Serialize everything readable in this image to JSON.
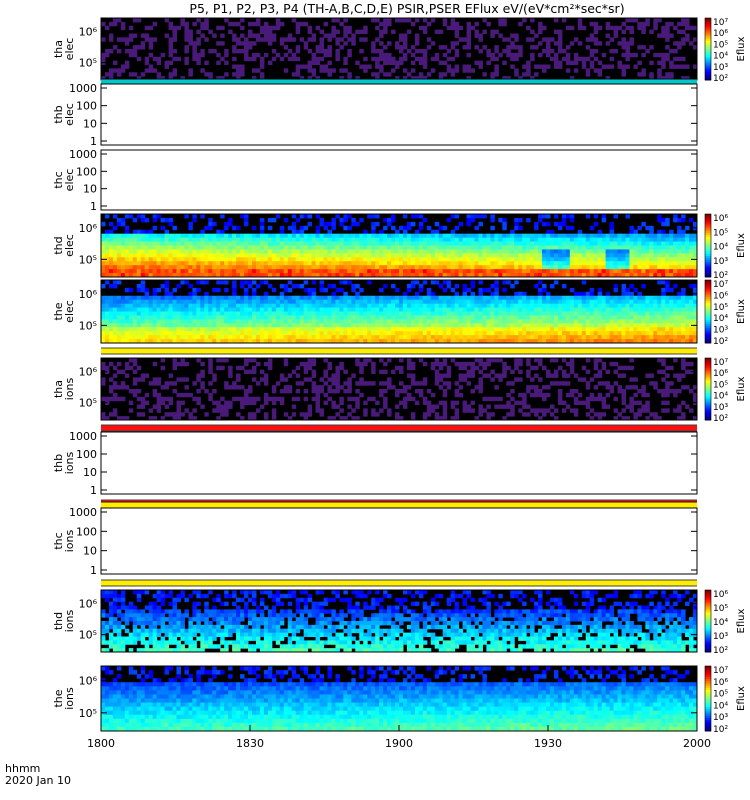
{
  "title": "P5, P1, P2, P3, P4 (TH-A,B,C,D,E) PSIR,PSER EFlux eV/(eV*cm²*sec*sr)",
  "footer": {
    "line1": "hhmm",
    "line2": "2020 Jan 10"
  },
  "colors": {
    "background": "#ffffff",
    "frame": "#000000",
    "no_data_line_cyan": "#00c8c8",
    "no_data_line_red": "#ff1010",
    "no_data_line_yellow": "#ffee00"
  },
  "chart_data": {
    "type": "heatmap",
    "xlabel": "",
    "x_ticks": [
      "1800",
      "1830",
      "1900",
      "1930",
      "2000"
    ],
    "x_range": [
      "18:00",
      "20:00"
    ],
    "colorbar_label": "Eflux",
    "panels": [
      {
        "id": "tha_elec",
        "ylabel": [
          "tha",
          "elec"
        ],
        "yscale": "log",
        "y_ticks": [
          "10⁶",
          "10⁵"
        ],
        "has_data": true,
        "colorbar_ticks": [
          "10⁷",
          "10⁶",
          "10⁵",
          "10⁴",
          "10³",
          "10²"
        ],
        "style": "sparse",
        "bottom_line": "cyan"
      },
      {
        "id": "thb_elec",
        "ylabel": [
          "thb",
          "elec"
        ],
        "yscale": "log",
        "y_ticks": [
          "1000",
          "100",
          "10",
          "1"
        ],
        "has_data": false
      },
      {
        "id": "thc_elec",
        "ylabel": [
          "thc",
          "elec"
        ],
        "yscale": "log",
        "y_ticks": [
          "1000",
          "100",
          "10",
          "1"
        ],
        "has_data": false
      },
      {
        "id": "thd_elec",
        "ylabel": [
          "thd",
          "elec"
        ],
        "yscale": "log",
        "y_ticks": [
          "10⁶",
          "10⁵"
        ],
        "has_data": true,
        "colorbar_ticks": [
          "10⁶",
          "10⁵",
          "10⁴",
          "10³",
          "10²"
        ],
        "style": "dense_thd_elec"
      },
      {
        "id": "the_elec",
        "ylabel": [
          "the",
          "elec"
        ],
        "yscale": "log",
        "y_ticks": [
          "10⁶",
          "10⁵"
        ],
        "has_data": true,
        "colorbar_ticks": [
          "10⁷",
          "10⁶",
          "10⁵",
          "10⁴",
          "10³",
          "10²"
        ],
        "style": "dense_the_elec",
        "bottom_line": "yellow"
      },
      {
        "id": "tha_ions",
        "ylabel": [
          "tha",
          "ions"
        ],
        "yscale": "log",
        "y_ticks": [
          "10⁶",
          "10⁵"
        ],
        "has_data": true,
        "colorbar_ticks": [
          "10⁷",
          "10⁶",
          "10⁵",
          "10⁴",
          "10³",
          "10²"
        ],
        "style": "sparse",
        "bottom_line": "red"
      },
      {
        "id": "thb_ions",
        "ylabel": [
          "thb",
          "ions"
        ],
        "yscale": "log",
        "y_ticks": [
          "1000",
          "100",
          "10",
          "1"
        ],
        "has_data": false,
        "bottom_line": "red"
      },
      {
        "id": "thc_ions",
        "ylabel": [
          "thc",
          "ions"
        ],
        "yscale": "log",
        "y_ticks": [
          "1000",
          "100",
          "10",
          "1"
        ],
        "has_data": false,
        "bottom_line": "yellow"
      },
      {
        "id": "thd_ions",
        "ylabel": [
          "thd",
          "ions"
        ],
        "yscale": "log",
        "y_ticks": [
          "10⁶",
          "10⁵"
        ],
        "has_data": true,
        "colorbar_ticks": [
          "10⁶",
          "10⁵",
          "10⁴",
          "10³",
          "10²"
        ],
        "style": "mid_thd_ions",
        "bottom_line": "yellow"
      },
      {
        "id": "the_ions",
        "ylabel": [
          "the",
          "ions"
        ],
        "yscale": "log",
        "y_ticks": [
          "10⁶",
          "10⁵"
        ],
        "has_data": true,
        "colorbar_ticks": [
          "10⁷",
          "10⁶",
          "10⁵",
          "10⁴",
          "10³",
          "10²"
        ],
        "style": "mid_the_ions"
      }
    ]
  }
}
